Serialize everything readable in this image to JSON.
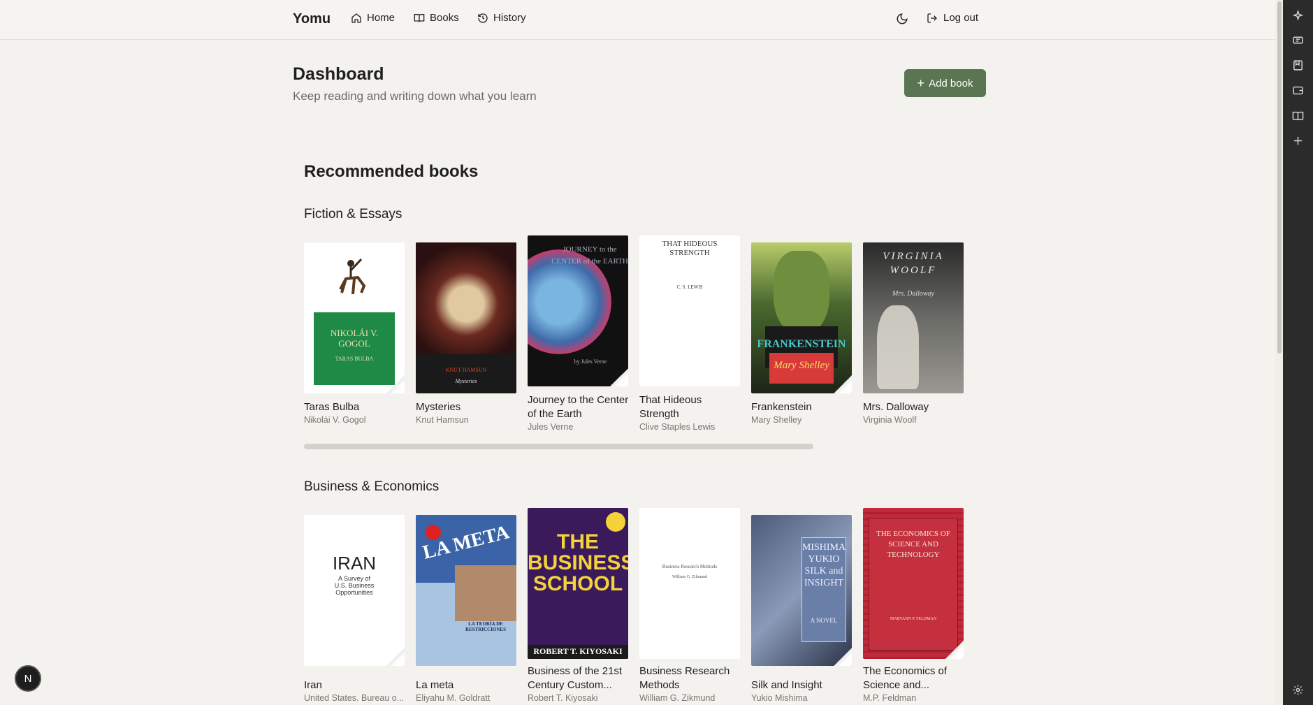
{
  "nav": {
    "brand": "Yomu",
    "home": "Home",
    "books": "Books",
    "history": "History",
    "logout": "Log out"
  },
  "header": {
    "title": "Dashboard",
    "subtitle": "Keep reading and writing down what you learn",
    "add_book": "Add book"
  },
  "recommended": {
    "title": "Recommended books",
    "categories": [
      {
        "name": "Fiction & Essays",
        "books": [
          {
            "title": "Taras Bulba",
            "author": "Nikolái V. Gogol"
          },
          {
            "title": "Mysteries",
            "author": "Knut Hamsun"
          },
          {
            "title": "Journey to the Center of the Earth",
            "author": "Jules Verne"
          },
          {
            "title": "That Hideous Strength",
            "author": "Clive Staples Lewis"
          },
          {
            "title": "Frankenstein",
            "author": "Mary Shelley"
          },
          {
            "title": "Mrs. Dalloway",
            "author": "Virginia Woolf"
          }
        ]
      },
      {
        "name": "Business & Economics",
        "books": [
          {
            "title": "Iran",
            "author": "United States. Bureau o..."
          },
          {
            "title": "La meta",
            "author": "Eliyahu M. Goldratt"
          },
          {
            "title": "Business of the 21st Century Custom...",
            "author": "Robert T. Kiyosaki"
          },
          {
            "title": "Business Research Methods",
            "author": "William G. Zikmund"
          },
          {
            "title": "Silk and Insight",
            "author": "Yukio Mishima"
          },
          {
            "title": "The Economics of Science and...",
            "author": "M.P. Feldman"
          }
        ]
      }
    ]
  },
  "covers": {
    "taras": {
      "name": "NIKOLÁI V. GOGOL",
      "sub": "TARAS BULBA"
    },
    "mysteries": {
      "name": "KNUT HAMSUN",
      "sub": "Mysteries"
    },
    "journey": {
      "name": "JOURNEY to the CENTER of the EARTH",
      "sub": "by Jules Verne"
    },
    "hideous": {
      "name": "THAT HIDEOUS STRENGTH",
      "sub": "C. S. LEWIS"
    },
    "frank": {
      "name": "FRANKENSTEIN",
      "sub": "Mary Shelley"
    },
    "dalloway": {
      "name": "VIRGINIA WOOLF",
      "sub": "Mrs. Dalloway"
    },
    "iran": {
      "name": "IRAN",
      "sub": "A Survey of U.S. Business Opportunities"
    },
    "lameta": {
      "name": "LA META",
      "sub": "LA TEORÍA DE RESTRICCIONES"
    },
    "business": {
      "name": "THE BUSINESS SCHOOL",
      "sub": "ROBERT T. KIYOSAKI"
    },
    "research": {
      "name": "Business Research Methods",
      "sub": "William G. Zikmund"
    },
    "silk": {
      "name": "MISHIMA YUKIO SILK and INSIGHT",
      "sub": "A NOVEL"
    },
    "econ": {
      "name": "THE ECONOMICS OF SCIENCE AND TECHNOLOGY",
      "sub": "MARYANN P. FELDMAN"
    }
  },
  "user": {
    "initial": "N"
  },
  "colors": {
    "accent": "#5a7551",
    "sidebar": "#2b2b2b"
  }
}
